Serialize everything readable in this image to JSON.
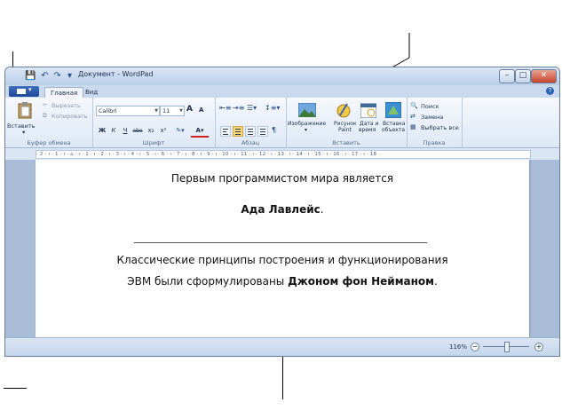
{
  "titlebar": {
    "title": "Документ - WordPad",
    "qa_arrow": "▾",
    "minimize": "–",
    "maximize": "□",
    "close": "✕"
  },
  "tabs": [
    {
      "label": "Главная",
      "active": true
    },
    {
      "label": "Вид",
      "active": false
    }
  ],
  "help_glyph": "?",
  "ribbon": {
    "clipboard": {
      "label": "Буфер обмена",
      "paste": "Вставить",
      "cut": "Вырезать",
      "copy": "Копировать"
    },
    "font": {
      "label": "Шрифт",
      "family": "Calibri",
      "size": "11",
      "grow": "A",
      "shrink": "A",
      "bold": "Ж",
      "italic": "К",
      "underline": "Ч",
      "strike": "abe",
      "subscript": "x₂",
      "superscript": "x²"
    },
    "paragraph": {
      "label": "Абзац"
    },
    "insert": {
      "label": "Вставить",
      "picture": "Изображение",
      "paint_line1": "Рисунок",
      "paint_line2": "Paint",
      "datetime_line1": "Дата и",
      "datetime_line2": "время",
      "object_line1": "Вставка",
      "object_line2": "объекта"
    },
    "editing": {
      "label": "Правка",
      "find": "Поиск",
      "replace": "Замена",
      "select_all": "Выбрать все"
    }
  },
  "ruler": {
    "ticks": "· 2 · ı · 1 · ı · ⌂ · ı · 1 · ı · 2 · ı · 3 · ı · 4 · ı · 5 · ı · 6 · ı · 7 · ı · 8 · ı · 9 · ı · 10 · ı · 11 · ı · 12 · ı · 13 · ı · 14 · ı · 15 · ı · 16 · ı · 17 · ı · 18 ·"
  },
  "document": {
    "line1": "Первым программистом мира является",
    "line2_bold": "Ада Лавлейс",
    "line2_tail": ".",
    "line3": "Классические принципы построения и функционирования",
    "line4_head": "ЭВМ были сформулированы ",
    "line4_bold": "Джоном фон Нейманом",
    "line4_tail": "."
  },
  "status": {
    "zoom": "116%",
    "zoom_out": "−",
    "zoom_in": "+"
  },
  "colors": {
    "accent": "#2c63b8",
    "ribbon_bg": "#dde8f5",
    "doc_bg": "#a9bcd8",
    "close_red": "#c6432b"
  }
}
